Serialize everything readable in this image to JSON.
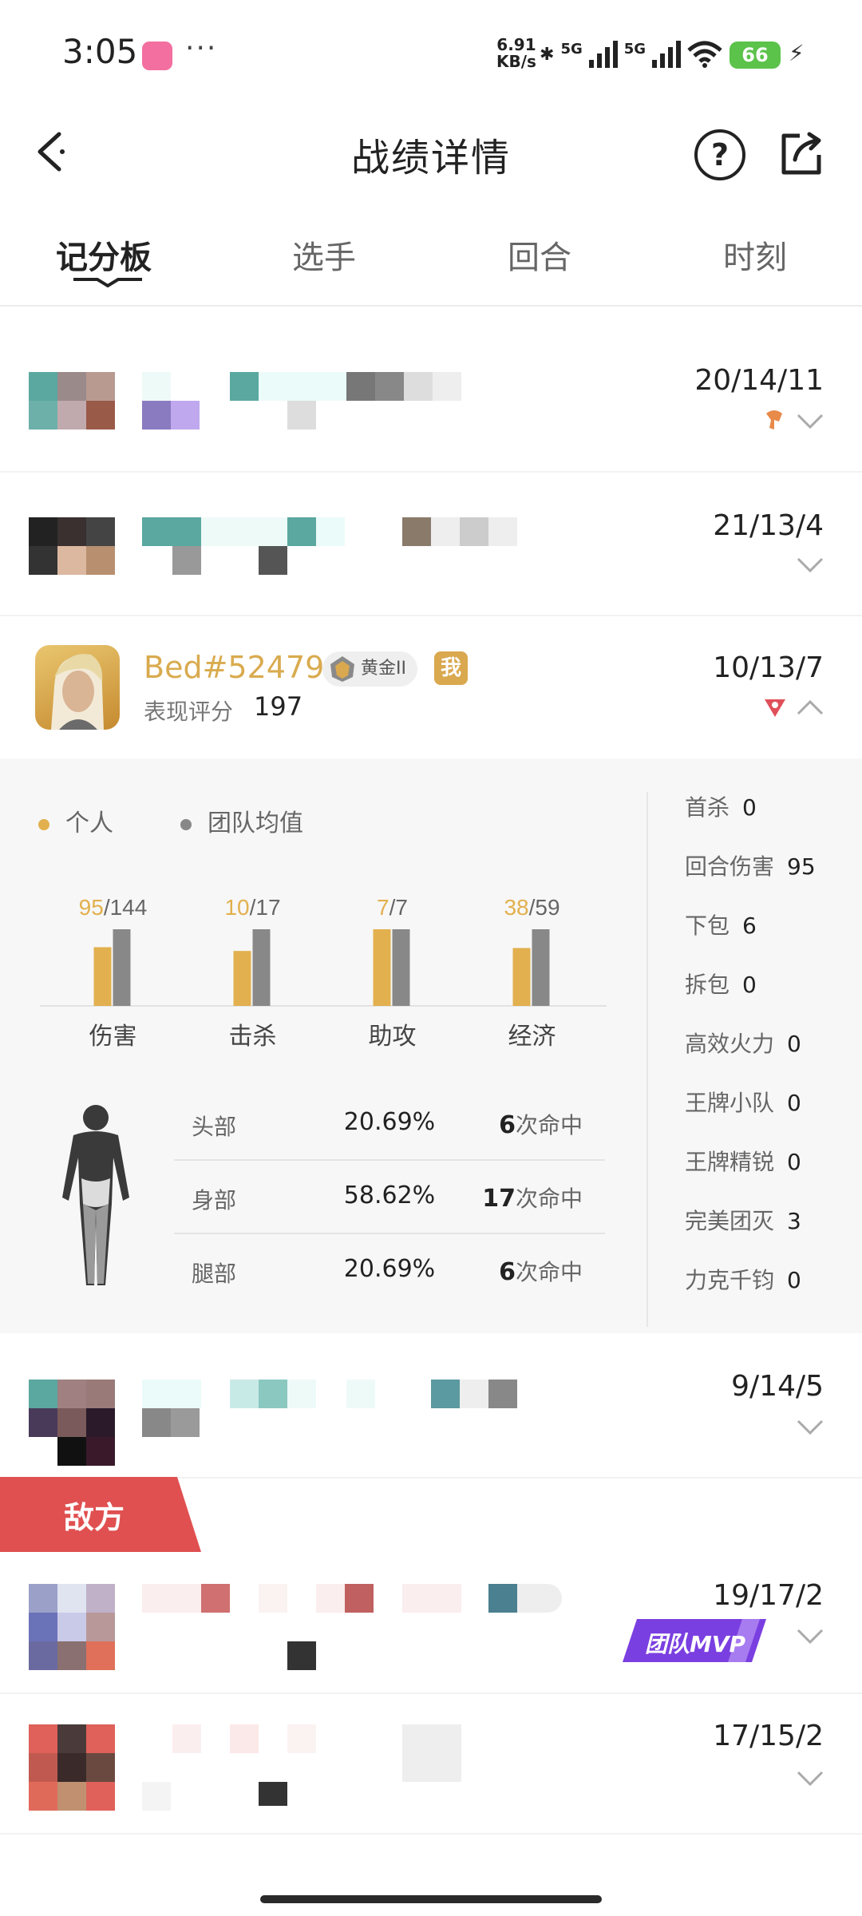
{
  "status": {
    "time": "3:05",
    "more": "···",
    "net_speed": "6.91",
    "net_unit": "KB/s",
    "signal1": "5G",
    "signal2": "5G",
    "battery": "66"
  },
  "header": {
    "title": "战绩详情",
    "help": "?"
  },
  "tabs": [
    "记分板",
    "选手",
    "回合",
    "时刻"
  ],
  "players_top": [
    {
      "score": "20/14/11"
    },
    {
      "score": "21/13/4"
    }
  ],
  "me": {
    "name": "Bed#52479",
    "rank": "黄金II",
    "badge": "我",
    "rating_label": "表现评分",
    "rating_value": "197",
    "score": "10/13/7"
  },
  "detail": {
    "legend": [
      "个人",
      "团队均值"
    ],
    "colors": {
      "personal": "#e2b04e",
      "team": "#888888",
      "accent": "#d9ab4f",
      "enemy": "#e05050",
      "mvp": "#7a3fe0"
    },
    "chart_data": {
      "type": "bar",
      "categories": [
        "伤害",
        "击杀",
        "助攻",
        "经济"
      ],
      "series": [
        {
          "name": "个人",
          "values": [
            95,
            10,
            7,
            38
          ]
        },
        {
          "name": "团队均值",
          "values": [
            144,
            17,
            7,
            59
          ]
        }
      ],
      "value_labels": [
        {
          "mine": "95",
          "avg": "144"
        },
        {
          "mine": "10",
          "avg": "17"
        },
        {
          "mine": "7",
          "avg": "7"
        },
        {
          "mine": "38",
          "avg": "59"
        }
      ]
    },
    "hits": [
      {
        "part": "头部",
        "pct": "20.69%",
        "count": "6",
        "unit": "次命中"
      },
      {
        "part": "身部",
        "pct": "58.62%",
        "count": "17",
        "unit": "次命中"
      },
      {
        "part": "腿部",
        "pct": "20.69%",
        "count": "6",
        "unit": "次命中"
      }
    ],
    "stats": [
      {
        "label": "首杀",
        "value": "0"
      },
      {
        "label": "回合伤害",
        "value": "95"
      },
      {
        "label": "下包",
        "value": "6"
      },
      {
        "label": "拆包",
        "value": "0"
      },
      {
        "label": "高效火力",
        "value": "0"
      },
      {
        "label": "王牌小队",
        "value": "0"
      },
      {
        "label": "王牌精锐",
        "value": "0"
      },
      {
        "label": "完美团灭",
        "value": "3"
      },
      {
        "label": "力克千钧",
        "value": "0"
      }
    ]
  },
  "players_bottom": [
    {
      "score": "9/14/5"
    }
  ],
  "enemy": {
    "label": "敌方",
    "mvp": "团队MVP",
    "players": [
      {
        "score": "19/17/2"
      },
      {
        "score": "17/15/2"
      }
    ]
  }
}
